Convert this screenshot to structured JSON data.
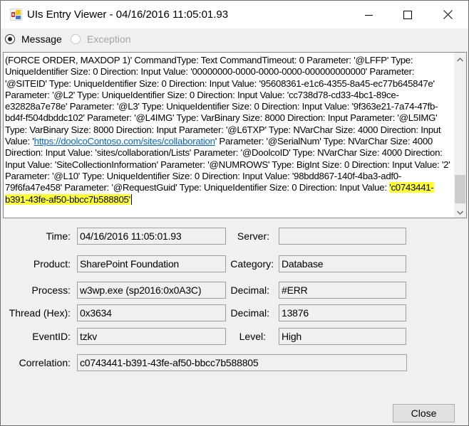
{
  "window": {
    "title": "UIs Entry Viewer - 04/16/2016 11:05:01.93",
    "icon": "app-icon",
    "controls": {
      "minimize": "minimize-icon",
      "maximize": "maximize-icon",
      "close": "close-icon"
    }
  },
  "view_mode": {
    "options": [
      {
        "label": "Message",
        "selected": true,
        "enabled": true
      },
      {
        "label": "Exception",
        "selected": false,
        "enabled": false
      }
    ]
  },
  "message": {
    "before_link": "(FORCE ORDER, MAXDOP 1)'     CommandType: Text CommandTimeout: 0     Parameter: '@LFFP' Type: UniqueIdentifier Size: 0 Direction: Input Value: '00000000-0000-0000-0000-000000000000'     Parameter: '@SITEID' Type: UniqueIdentifier Size: 0 Direction: Input Value: '95608361-e1c6-4355-8a45-ec77b645847e'     Parameter: '@L2' Type: UniqueIdentifier Size: 0 Direction: Input Value: 'cc738d78-cd33-4bc1-89ce-e32828a7e78e'     Parameter: '@L3' Type: UniqueIdentifier Size: 0 Direction: Input Value: '9f363e21-7a74-47fb-bd4f-f504dbddc102'     Parameter: '@L4IMG' Type: VarBinary Size: 8000 Direction: Input     Parameter: '@L5IMG' Type: VarBinary Size: 8000 Direction: Input     Parameter: '@L6TXP' Type: NVarChar Size: 4000 Direction: Input Value: '",
    "link": "https://doolcoContoso.com/sites/collaboration",
    "after_link": "'     Parameter: '@SerialNum' Type: NVarChar Size: 4000 Direction: Input Value: 'sites/collaboration/Lists'     Parameter: '@DoolcoID' Type: NVarChar Size: 4000 Direction: Input Value: 'SiteCollectionInformation'     Parameter: '@NUMROWS' Type: BigInt Size: 0 Direction: Input Value: '2'     Parameter: '@L10' Type: UniqueIdentifier Size: 0 Direction: Input Value: '98bdd867-140f-4ba3-adf0-79f6fa47e458'     Parameter: '@RequestGuid' Type: UniqueIdentifier Size: 0 Direction: Input Value: ",
    "highlighted": "'c0743441-b391-43fe-af50-bbcc7b588805'",
    "highlight_color": "#ffff33",
    "link_color": "#0066cc"
  },
  "fields": {
    "time": {
      "label": "Time:",
      "value": "04/16/2016 11:05:01.93"
    },
    "server": {
      "label": "Server:",
      "value": ""
    },
    "product": {
      "label": "Product:",
      "value": "SharePoint Foundation"
    },
    "category": {
      "label": "Category:",
      "value": "Database"
    },
    "process": {
      "label": "Process:",
      "value": "w3wp.exe (sp2016:0x0A3C)"
    },
    "process_decimal": {
      "label": "Decimal:",
      "value": "#ERR"
    },
    "thread": {
      "label": "Thread (Hex):",
      "value": "0x3634"
    },
    "thread_decimal": {
      "label": "Decimal:",
      "value": "13876"
    },
    "event_id": {
      "label": "EventID:",
      "value": "tzkv"
    },
    "level": {
      "label": "Level:",
      "value": "High"
    },
    "correlation": {
      "label": "Correlation:",
      "value": "c0743441-b391-43fe-af50-bbcc7b588805"
    }
  },
  "buttons": {
    "close": "Close"
  }
}
